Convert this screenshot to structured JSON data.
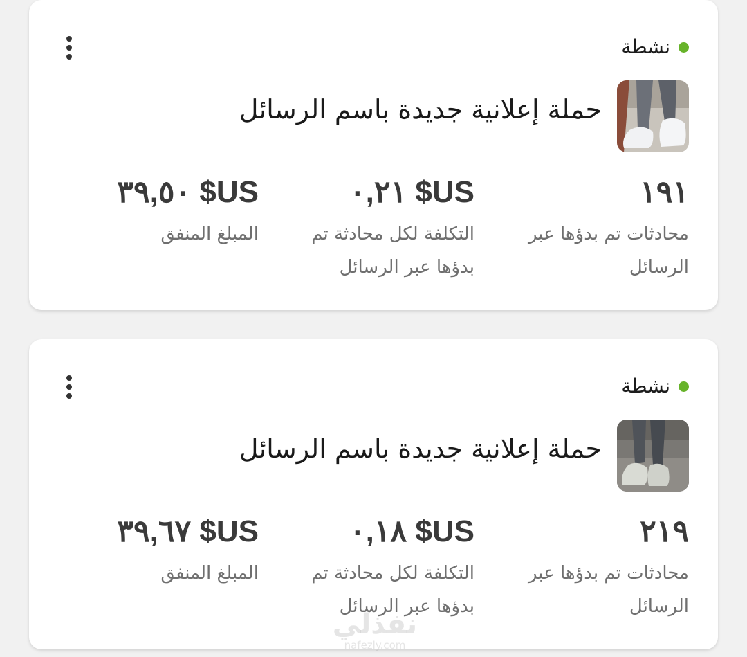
{
  "campaigns": [
    {
      "status": "نشطة",
      "title": "حملة إعلانية جديدة باسم الرسائل",
      "metrics": [
        {
          "value": "١٩١",
          "label": "محادثات تم بدؤها عبر الرسائل"
        },
        {
          "value": "US$ ٠,٢١",
          "label": "التكلفة لكل محادثة تم بدؤها عبر الرسائل"
        },
        {
          "value": "US$ ٣٩,٥٠",
          "label": "المبلغ المنفق"
        }
      ]
    },
    {
      "status": "نشطة",
      "title": "حملة إعلانية جديدة باسم الرسائل",
      "metrics": [
        {
          "value": "٢١٩",
          "label": "محادثات تم بدؤها عبر الرسائل"
        },
        {
          "value": "US$ ٠,١٨",
          "label": "التكلفة لكل محادثة تم بدؤها عبر الرسائل"
        },
        {
          "value": "US$ ٣٩,٦٧",
          "label": "المبلغ المنفق"
        }
      ]
    }
  ],
  "icons": {
    "more": "more-vertical-icon",
    "status": "status-dot-icon"
  },
  "colors": {
    "status_active": "#67b32a",
    "card_bg": "#ffffff",
    "page_bg": "#f1f1f1"
  },
  "watermark": {
    "brand": "نفذلي",
    "domain": "nafezly.com"
  }
}
